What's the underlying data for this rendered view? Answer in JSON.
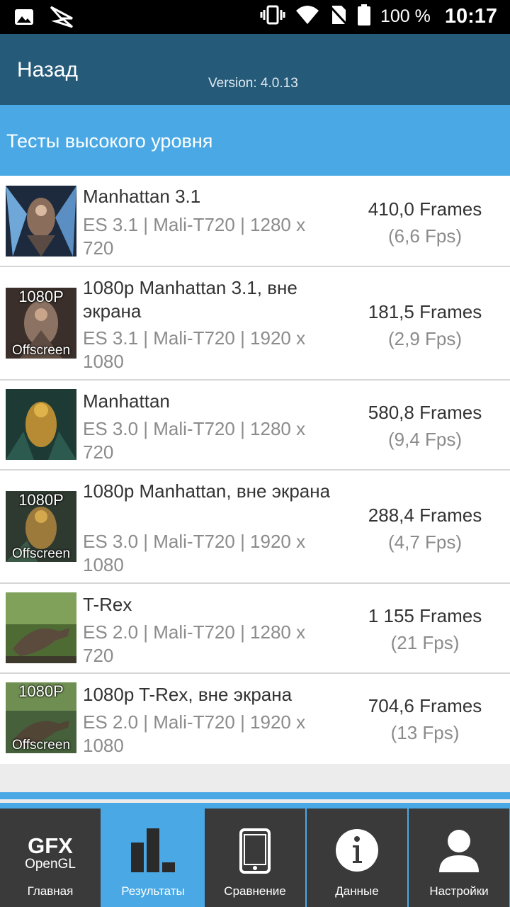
{
  "status_bar": {
    "battery_percent": "100 %",
    "time": "10:17",
    "icons": [
      "gallery-icon",
      "app-logo-icon",
      "vibrate-icon",
      "wifi-icon",
      "no-sim-icon",
      "battery-icon"
    ]
  },
  "header": {
    "back_label": "Назад",
    "version": "Version: 4.0.13"
  },
  "section": {
    "title": "Тесты высокого уровня"
  },
  "tests": [
    {
      "title": "Manhattan 3.1",
      "subtitle": "ES 3.1 | Mali-T720 | 1280 x 720",
      "frames": "410,0 Frames",
      "fps": "(6,6 Fps)",
      "badge_top": "",
      "badge_bottom": ""
    },
    {
      "title": "1080p Manhattan 3.1, вне экрана",
      "subtitle": "ES 3.1 | Mali-T720 | 1920 x 1080",
      "frames": "181,5 Frames",
      "fps": "(2,9 Fps)",
      "badge_top": "1080P",
      "badge_bottom": "Offscreen"
    },
    {
      "title": "Manhattan",
      "subtitle": "ES 3.0 | Mali-T720 | 1280 x 720",
      "frames": "580,8 Frames",
      "fps": "(9,4 Fps)",
      "badge_top": "",
      "badge_bottom": ""
    },
    {
      "title": "1080p Manhattan, вне экрана",
      "subtitle": "ES 3.0 | Mali-T720 | 1920 x 1080",
      "frames": "288,4 Frames",
      "fps": "(4,7 Fps)",
      "badge_top": "1080P",
      "badge_bottom": "Offscreen"
    },
    {
      "title": "T-Rex",
      "subtitle": "ES 2.0 | Mali-T720 | 1280 x 720",
      "frames": "1 155 Frames",
      "fps": "(21 Fps)",
      "badge_top": "",
      "badge_bottom": ""
    },
    {
      "title": "1080p T-Rex, вне экрана",
      "subtitle": "ES 2.0 | Mali-T720 | 1920 x 1080",
      "frames": "704,6 Frames",
      "fps": "(13 Fps)",
      "badge_top": "1080P",
      "badge_bottom": "Offscreen"
    }
  ],
  "nav": {
    "active": "results",
    "logo_gfx": "GFX",
    "logo_opengl": "OpenGL",
    "tabs": [
      {
        "label": "Главная",
        "icon": "gfx-logo-icon"
      },
      {
        "label": "Результаты",
        "icon": "bar-chart-icon"
      },
      {
        "label": "Сравнение",
        "icon": "phone-icon"
      },
      {
        "label": "Данные",
        "icon": "info-icon"
      },
      {
        "label": "Настройки",
        "icon": "person-icon"
      }
    ]
  },
  "colors": {
    "header_bg": "#255a79",
    "accent": "#4aa9e5",
    "nav_bg": "#3a3a3a"
  }
}
